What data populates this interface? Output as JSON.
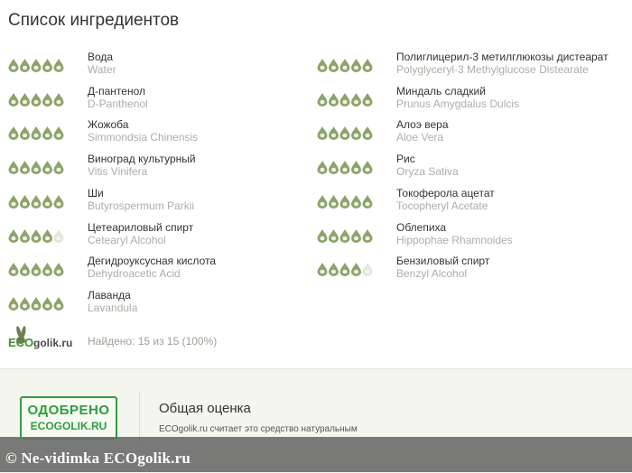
{
  "page_title": "Список ингредиентов",
  "colors": {
    "drop_full": "#8da36a",
    "drop_empty": "#e3e7dc",
    "stamp_green": "#2e9d3f"
  },
  "ingredients_left": [
    {
      "ru": "Вода",
      "lat": "Water",
      "rating": 5
    },
    {
      "ru": "Д-пантенол",
      "lat": "D-Panthenol",
      "rating": 5
    },
    {
      "ru": "Жожоба",
      "lat": "Simmondsia Chinensis",
      "rating": 5
    },
    {
      "ru": "Виноград культурный",
      "lat": "Vitis Vinifera",
      "rating": 5
    },
    {
      "ru": "Ши",
      "lat": "Butyrospermum Parkii",
      "rating": 5
    },
    {
      "ru": "Цетеариловый спирт",
      "lat": "Cetearyl Alcohol",
      "rating": 4
    },
    {
      "ru": "Дегидроуксусная кислота",
      "lat": "Dehydroacetic Acid",
      "rating": 5
    },
    {
      "ru": "Лаванда",
      "lat": "Lavandula",
      "rating": 5
    }
  ],
  "ingredients_right": [
    {
      "ru": "Полиглицерил-3 метилглюкозы дистеарат",
      "lat": "Polyglyceryl-3 Methylglucose Distearate",
      "rating": 5
    },
    {
      "ru": "Миндаль сладкий",
      "lat": "Prunus Amygdalus Dulcis",
      "rating": 5
    },
    {
      "ru": "Алоэ вера",
      "lat": "Aloe Vera",
      "rating": 5
    },
    {
      "ru": "Рис",
      "lat": "Oryza Sativa",
      "rating": 5
    },
    {
      "ru": "Токоферола ацетат",
      "lat": "Tocopheryl Acetate",
      "rating": 5
    },
    {
      "ru": "Облепиха",
      "lat": "Hippophae Rhamnoides",
      "rating": 5
    },
    {
      "ru": "Бензиловый спирт",
      "lat": "Benzyl Alcohol",
      "rating": 4
    }
  ],
  "logo": {
    "eco": "ECO",
    "rest": "golik.ru",
    "icon": "rabbit-icon"
  },
  "found_text": "Найдено: 15 из 15 (100%)",
  "stamp": {
    "line1": "ОДОБРЕНО",
    "line2": "ECOGOLIK.RU"
  },
  "rating": {
    "title": "Общая оценка",
    "desc": "ECOgolik.ru считает это средство натуральным"
  },
  "footer": {
    "text": "© Ne-vidimka ECOgolik.ru"
  }
}
